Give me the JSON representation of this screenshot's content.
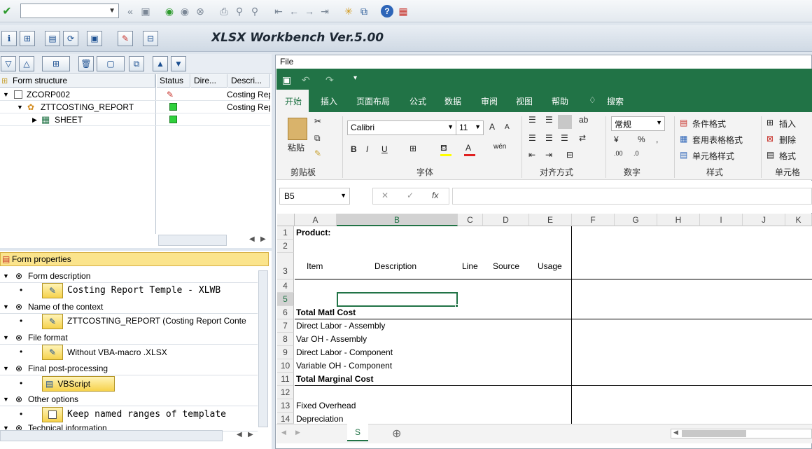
{
  "toolbar": {
    "command_field": "",
    "icons": [
      "enter-icon",
      "back-icon",
      "save-icon",
      "back-nav-icon",
      "exit-icon",
      "cancel-icon",
      "print-icon",
      "find-icon",
      "find-next-icon",
      "first-page-icon",
      "prev-page-icon",
      "next-page-icon",
      "last-page-icon",
      "new-session-icon",
      "shortcut-icon",
      "help-icon",
      "layout-icon"
    ]
  },
  "app": {
    "title": "XLSX Workbench Ver.5.00"
  },
  "tree": {
    "columns": [
      "Form structure",
      "Status",
      "Dire...",
      "Descri..."
    ],
    "rows": [
      {
        "label": "ZCORP002",
        "desc": "Costing Rep"
      },
      {
        "label": "ZTTCOSTING_REPORT",
        "desc": "Costing Rep"
      },
      {
        "label": "SHEET",
        "desc": ""
      }
    ]
  },
  "props": {
    "header": "Form properties",
    "groups": [
      {
        "label": "Form description",
        "value": "Costing Report Temple - XLWB"
      },
      {
        "label": "Name of the context",
        "value": "ZTTCOSTING_REPORT  (Costing Report Conte"
      },
      {
        "label": "File format",
        "value": "Without VBA-macro  .XLSX"
      },
      {
        "label": "Final post-processing",
        "value": "VBScript"
      },
      {
        "label": "Other options",
        "value": "Keep named ranges of template"
      },
      {
        "label": "Technical information",
        "value": ""
      }
    ]
  },
  "excel": {
    "file_menu": "File",
    "tabs": [
      "开始",
      "插入",
      "页面布局",
      "公式",
      "数据",
      "审阅",
      "视图",
      "帮助",
      "搜索"
    ],
    "clipboard": {
      "paste": "粘贴",
      "label": "剪贴板"
    },
    "font": {
      "name": "Calibri",
      "size": "11",
      "label": "字体"
    },
    "align": {
      "label": "对齐方式"
    },
    "number": {
      "format": "常规",
      "label": "数字"
    },
    "styles": {
      "cond": "条件格式",
      "table": "套用表格格式",
      "cell": "单元格样式",
      "label": "样式"
    },
    "cells": {
      "insert": "插入",
      "delete": "删除",
      "format": "格式",
      "label": "单元格"
    },
    "namebox": "B5",
    "columns": [
      "A",
      "B",
      "C",
      "D",
      "E",
      "F",
      "G",
      "H",
      "I",
      "J",
      "K"
    ],
    "rows": [
      "1",
      "2",
      "3",
      "4",
      "5",
      "6",
      "7",
      "8",
      "9",
      "10",
      "11",
      "12",
      "13",
      "14"
    ],
    "cells_text": {
      "product": "Product:",
      "item": "Item",
      "description": "Description",
      "line": "Line",
      "source": "Source",
      "usage": "Usage",
      "total_matl": "Total Matl Cost",
      "dl_assembly": "Direct Labor - Assembly",
      "varoh_assembly": "Var OH - Assembly",
      "dl_component": "Direct Labor - Component",
      "varoh_component": "Variable OH - Component",
      "total_marginal": "Total Marginal Cost",
      "fixed_overhead": "Fixed Overhead",
      "depreciation": "Depreciation"
    },
    "sheet_tab": "S"
  }
}
